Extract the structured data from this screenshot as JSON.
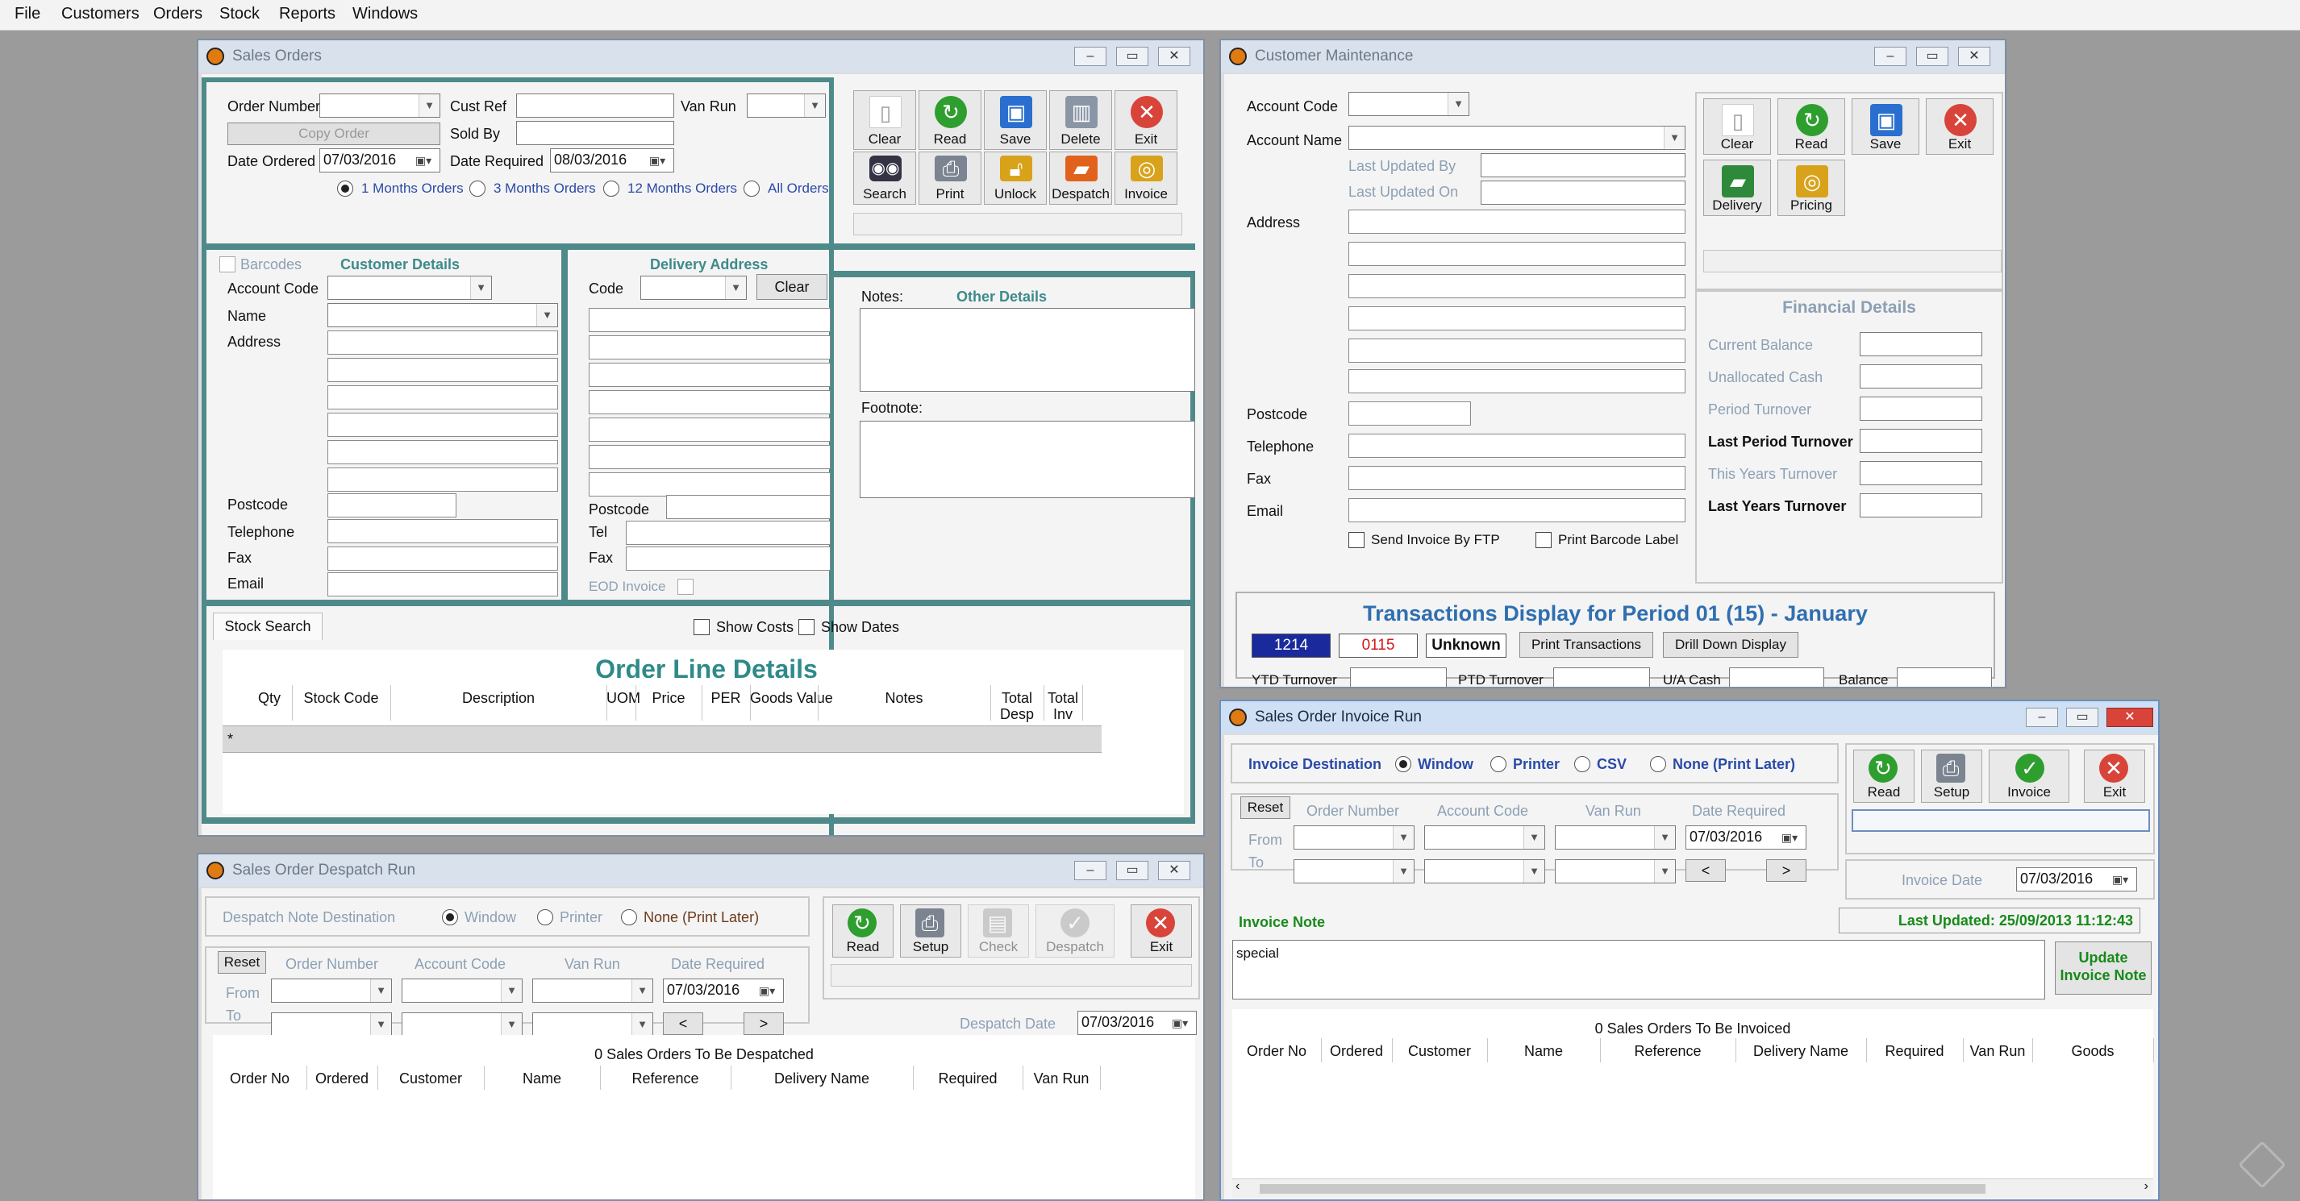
{
  "menu": [
    "File",
    "Customers",
    "Orders",
    "Stock",
    "Reports",
    "Windows"
  ],
  "colors": {
    "accent_teal": "#4f8a8b",
    "teal_text": "#3e8a8a",
    "green": "#178a1a",
    "blue_chip": "#1a2a9c",
    "red_chip": "#d01818",
    "exit_red": "#d8443a"
  },
  "sales_orders": {
    "title": "Sales Orders",
    "order_number_label": "Order Number",
    "cust_ref_label": "Cust Ref",
    "van_run_label": "Van Run",
    "copy_order": "Copy Order",
    "sold_by_label": "Sold By",
    "date_ordered_label": "Date Ordered",
    "date_ordered": "07/03/2016",
    "date_required_label": "Date Required",
    "date_required": "08/03/2016",
    "range_options": [
      "1 Months Orders",
      "3 Months Orders",
      "12 Months Orders",
      "All Orders"
    ],
    "toolbar": [
      "Clear",
      "Read",
      "Save",
      "Delete",
      "Exit",
      "Search",
      "Print",
      "Unlock",
      "Despatch",
      "Invoice"
    ],
    "barcodes": "Barcodes",
    "customer_details": "Customer Details",
    "account_code": "Account Code",
    "name": "Name",
    "address": "Address",
    "postcode": "Postcode",
    "telephone": "Telephone",
    "fax": "Fax",
    "email": "Email",
    "delivery_address": "Delivery Address",
    "code": "Code",
    "clear": "Clear",
    "tel": "Tel",
    "eod_invoice": "EOD Invoice",
    "notes_label": "Notes:",
    "other_details": "Other Details",
    "footnote_label": "Footnote:",
    "stock_search_tab": "Stock Search",
    "show_costs": "Show Costs",
    "show_dates": "Show Dates",
    "order_line_details": "Order Line Details",
    "columns": [
      "Qty",
      "Stock Code",
      "Description",
      "UOM",
      "Price",
      "PER",
      "Goods Value",
      "Notes",
      "Total Desp",
      "Total Inv"
    ],
    "new_row_marker": "*"
  },
  "customer_maint": {
    "title": "Customer Maintenance",
    "account_code": "Account Code",
    "account_name": "Account Name",
    "last_updated_by": "Last Updated By",
    "last_updated_on": "Last Updated On",
    "address": "Address",
    "postcode": "Postcode",
    "telephone": "Telephone",
    "fax": "Fax",
    "email": "Email",
    "send_invoice_ftp": "Send Invoice By FTP",
    "print_barcode_label": "Print Barcode Label",
    "toolbar": [
      "Clear",
      "Read",
      "Save",
      "Exit",
      "Delivery",
      "Pricing"
    ],
    "financial_details": "Financial Details",
    "fin_rows": [
      "Current Balance",
      "Unallocated Cash",
      "Period Turnover",
      "Last Period Turnover",
      "This Years Turnover",
      "Last Years Turnover"
    ],
    "transactions_title": "Transactions Display for Period 01 (15) - January",
    "chip_blue": "1214",
    "chip_red": "0115",
    "chip_unknown": "Unknown",
    "print_transactions": "Print Transactions",
    "drill_down": "Drill Down Display",
    "ytd_turnover": "YTD Turnover",
    "ptd_turnover": "PTD Turnover",
    "ua_cash": "U/A Cash",
    "balance": "Balance"
  },
  "despatch_run": {
    "title": "Sales Order Despatch Run",
    "destination_label": "Despatch Note Destination",
    "options": [
      "Window",
      "Printer",
      "None (Print Later)"
    ],
    "reset": "Reset",
    "order_number": "Order Number",
    "account_code": "Account Code",
    "van_run": "Van Run",
    "date_required": "Date Required",
    "date_value": "07/03/2016",
    "from": "From",
    "to": "To",
    "prev": "<",
    "next": ">",
    "toolbar": [
      "Read",
      "Setup",
      "Check",
      "Despatch",
      "Exit"
    ],
    "despatch_date_label": "Despatch Date",
    "despatch_date": "07/03/2016",
    "count_text": "0 Sales Orders To Be Despatched",
    "columns": [
      "Order No",
      "Ordered",
      "Customer",
      "Name",
      "Reference",
      "Delivery Name",
      "Required",
      "Van Run"
    ]
  },
  "invoice_run": {
    "title": "Sales Order Invoice Run",
    "destination_label": "Invoice Destination",
    "options": [
      "Window",
      "Printer",
      "CSV",
      "None (Print Later)"
    ],
    "reset": "Reset",
    "order_number": "Order Number",
    "account_code": "Account Code",
    "van_run": "Van Run",
    "date_required": "Date Required",
    "date_value": "07/03/2016",
    "from": "From",
    "to": "To",
    "prev": "<",
    "next": ">",
    "toolbar": [
      "Read",
      "Setup",
      "Invoice",
      "Exit"
    ],
    "invoice_date_label": "Invoice Date",
    "invoice_date": "07/03/2016",
    "invoice_note_label": "Invoice Note",
    "last_updated": "Last Updated: 25/09/2013 11:12:43",
    "note_text": "special",
    "update_note": "Update Invoice Note",
    "count_text": "0 Sales Orders To Be Invoiced",
    "columns": [
      "Order No",
      "Ordered",
      "Customer",
      "Name",
      "Reference",
      "Delivery Name",
      "Required",
      "Van Run",
      "Goods"
    ]
  }
}
